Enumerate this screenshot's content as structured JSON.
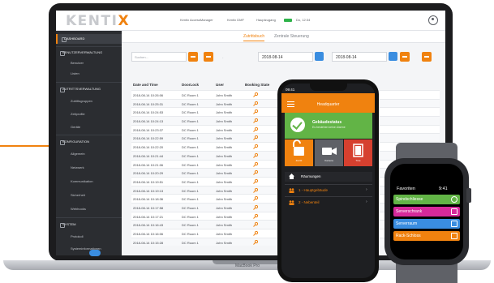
{
  "colors": {
    "accent": "#f0820f",
    "sidebar_bg": "#2b2d31",
    "status_green": "#62b446",
    "action_blue": "#3a8de0"
  },
  "web": {
    "logo_prefix": "KENTI",
    "logo_suffix": "X",
    "top_info": [
      "Kentix AccessManager",
      "Kentix DMF",
      "Hauptzugang",
      "Do, 12:34"
    ],
    "sidebar": [
      {
        "label": "DASHBOARD",
        "type": "head",
        "active": true
      },
      {
        "label": "BENUTZERVERWALTUNG",
        "type": "head"
      },
      {
        "label": "Benutzer",
        "type": "item"
      },
      {
        "label": "Listen",
        "type": "item"
      },
      {
        "label": "ZUTRITTSVERWALTUNG",
        "type": "head"
      },
      {
        "label": "Zutrittsgruppen",
        "type": "item"
      },
      {
        "label": "Zeitprofile",
        "type": "item"
      },
      {
        "label": "Geräte",
        "type": "item"
      },
      {
        "label": "KONFIGURATION",
        "type": "head"
      },
      {
        "label": "Allgemein",
        "type": "item"
      },
      {
        "label": "Netzwerk",
        "type": "item"
      },
      {
        "label": "Kommunikation",
        "type": "item"
      },
      {
        "label": "Sicherheit",
        "type": "item"
      },
      {
        "label": "Webhooks",
        "type": "item"
      },
      {
        "label": "SYSTEM",
        "type": "head"
      },
      {
        "label": "Protokoll",
        "type": "item"
      },
      {
        "label": "Systeminformationen",
        "type": "item"
      }
    ],
    "tabs": [
      "Zutrittsbuch",
      "Zentrale Steuerung"
    ],
    "search_placeholder": "Suchen...",
    "filter_separator": "-",
    "date_from": "2018-08-14",
    "date_to": "2018-08-14",
    "table": {
      "headers": [
        "Date and Time",
        "DoorLock",
        "User",
        "Booking State",
        "Detail"
      ],
      "rows": [
        [
          "2018-08-14 10:26:06",
          "DC Room 1",
          "John Smith"
        ],
        [
          "2018-08-14 10:25:31",
          "DC Room 1",
          "John Smith"
        ],
        [
          "2018-08-14 10:24:53",
          "DC Room 1",
          "John Smith"
        ],
        [
          "2018-08-14 10:24:13",
          "DC Room 1",
          "John Smith"
        ],
        [
          "2018-08-14 10:23:37",
          "DC Room 1",
          "John Smith"
        ],
        [
          "2018-08-14 10:22:59",
          "DC Room 1",
          "John Smith"
        ],
        [
          "2018-08-14 10:22:20",
          "DC Room 1",
          "John Smith"
        ],
        [
          "2018-08-14 10:21:44",
          "DC Room 1",
          "John Smith"
        ],
        [
          "2018-08-14 10:21:06",
          "DC Room 1",
          "John Smith"
        ],
        [
          "2018-08-14 10:20:29",
          "DC Room 1",
          "John Smith"
        ],
        [
          "2018-08-14 10:19:51",
          "DC Room 1",
          "John Smith"
        ],
        [
          "2018-08-14 10:19:13",
          "DC Room 1",
          "John Smith"
        ],
        [
          "2018-08-14 10:18:36",
          "DC Room 1",
          "John Smith"
        ],
        [
          "2018-08-14 10:17:58",
          "DC Room 1",
          "John Smith"
        ],
        [
          "2018-08-14 10:17:21",
          "DC Room 1",
          "John Smith"
        ],
        [
          "2018-08-14 10:16:43",
          "DC Room 1",
          "John Smith"
        ],
        [
          "2018-08-14 10:16:06",
          "DC Room 1",
          "John Smith"
        ],
        [
          "2018-08-14 10:15:28",
          "DC Room 1",
          "John Smith"
        ]
      ]
    },
    "laptop_model": "MacBook Pro"
  },
  "phone": {
    "status_time": "09:41",
    "title": "Headquarter",
    "status_card_title": "Gebäudestatus",
    "status_card_subtitle": "Es bestehen keine Alarme",
    "tiles": [
      {
        "label": "Zutritt",
        "color": "#f0820f",
        "icon": "unlock-icon"
      },
      {
        "label": "Kamera",
        "color": "#5f6167",
        "icon": "camera-icon"
      },
      {
        "label": "Türe",
        "color": "#d6402f",
        "icon": "door-icon"
      }
    ],
    "section_label": "Räumungen",
    "items": [
      "1 - Hauptgebäude",
      "2 - Nebenteil"
    ]
  },
  "watch": {
    "title": "Favoriten",
    "time": "9:41",
    "items": [
      {
        "label": "Spindschliesse",
        "color": "#62b446",
        "icon": "star-icon"
      },
      {
        "label": "Serverschrank",
        "color": "#d6299a",
        "icon": "rack-icon"
      },
      {
        "label": "Serverraum",
        "color": "#3a8de0",
        "icon": "key-icon"
      },
      {
        "label": "Rack-Schloss",
        "color": "#f0820f",
        "icon": "key-icon"
      }
    ]
  }
}
